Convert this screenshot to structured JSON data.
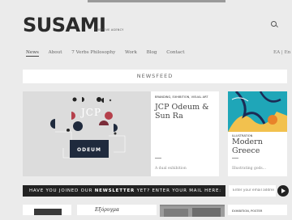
{
  "brand": {
    "name": "SUSAMI",
    "tagline": "CREATIVE AGENCY"
  },
  "nav": [
    "News",
    "About",
    "7 Verbs Philosophy",
    "Work",
    "Blog",
    "Contact"
  ],
  "lang": "EA | En",
  "section_title": "NEWSFEED",
  "posts": [
    {
      "tag": "BRANDING, EXHIBITION, VISUAL ART",
      "title": "JCP Odeum & Sun Ra",
      "excerpt": "A dual exhibition",
      "image_text": "JCP",
      "image_caption": "ODEUM"
    },
    {
      "tag": "ILLUSTRATION",
      "title": "Modern Greece",
      "excerpt": "Illustrating gods..."
    }
  ],
  "newsletter": {
    "prefix": "HAVE YOU JOINED OUR ",
    "bold": "NEWSLETTER",
    "suffix": " YET? ENTER YOUR MAIL HERE:",
    "placeholder": "Enter your email addres"
  },
  "bottom_row": {
    "book_title": "Εξόρυγμα",
    "tag": "EXHIBITION, POSTER"
  }
}
